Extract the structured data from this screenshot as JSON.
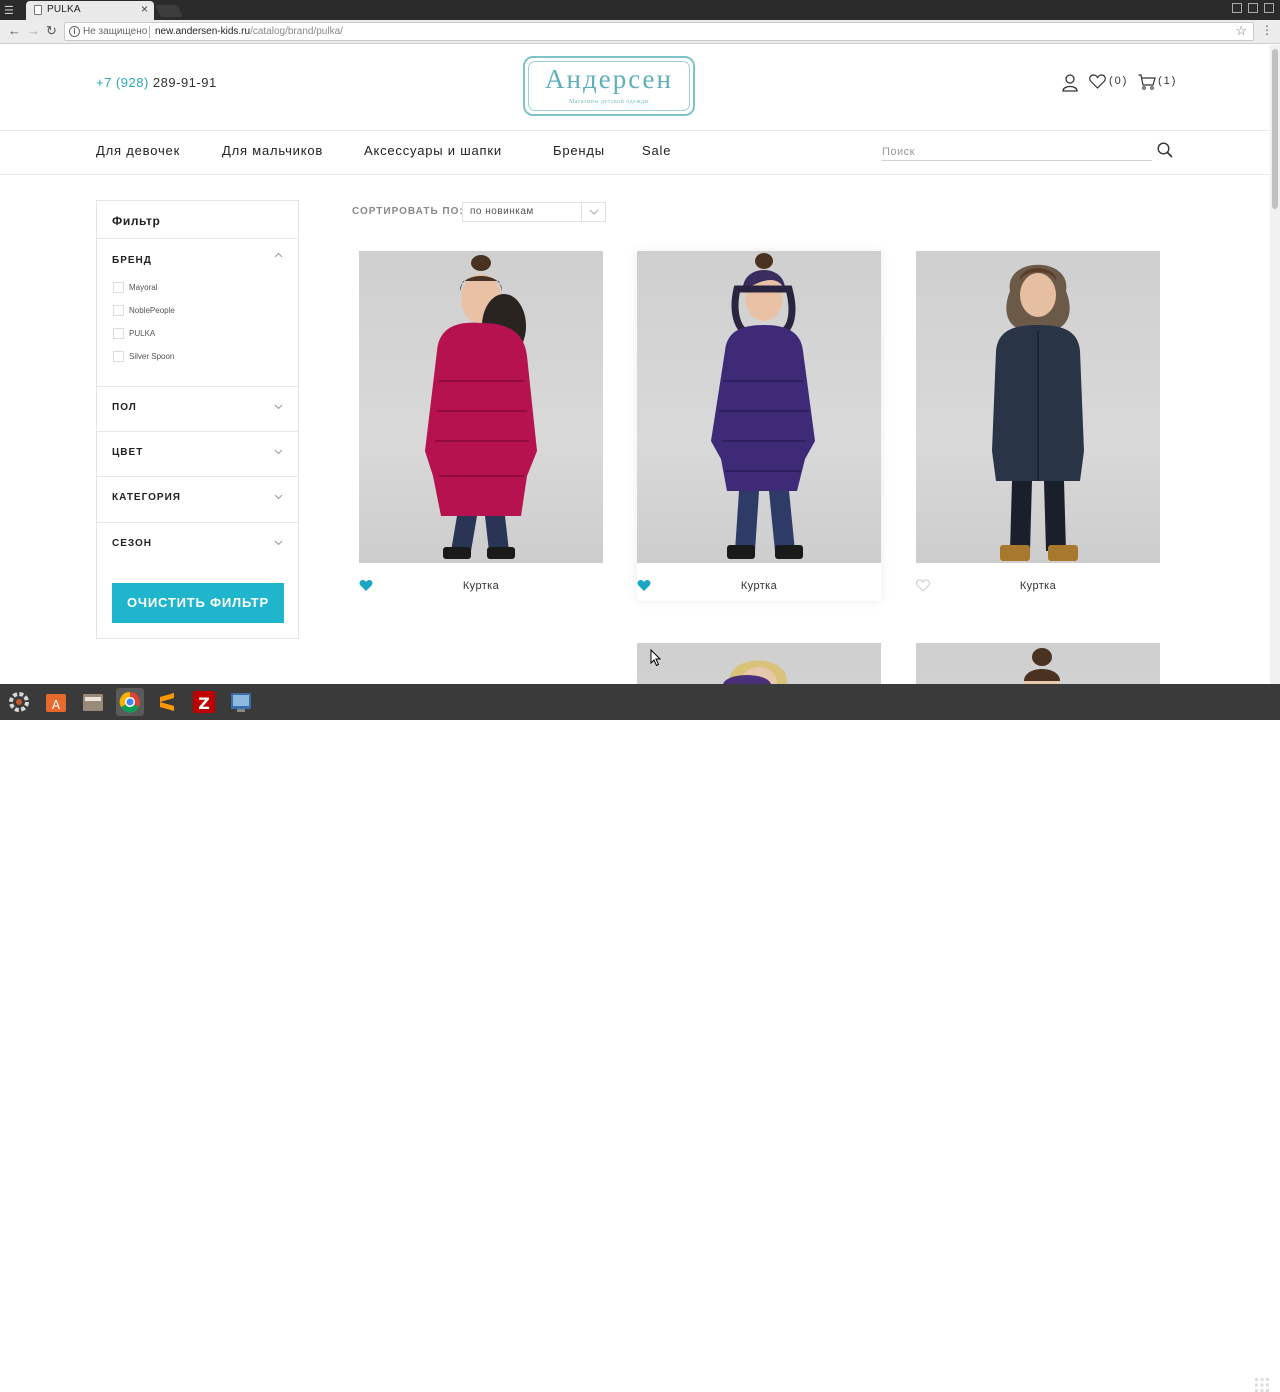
{
  "browser": {
    "tab_title": "PULKA",
    "insecure_label": "Не защищено",
    "url_host": "new.andersen-kids.ru",
    "url_path": "/catalog/brand/pulka/"
  },
  "header": {
    "phone_code": "+7 (928)",
    "phone_number": "289-91-91",
    "logo_name": "Андерсен",
    "logo_sub": "Магазины детской одежды",
    "wishlist_count": "(0)",
    "cart_count": "(1)"
  },
  "nav": {
    "items": [
      "Для девочек",
      "Для мальчиков",
      "Аксессуары и шапки",
      "Бренды",
      "Sale"
    ],
    "search_placeholder": "Поиск"
  },
  "filter": {
    "title": "Фильтр",
    "brand_heading": "БРЕНД",
    "brands": [
      "Mayoral",
      "NoblePeople",
      "PULKA",
      "Silver Spoon"
    ],
    "sections": [
      "ПОЛ",
      "ЦВЕТ",
      "КАТЕГОРИЯ",
      "СЕЗОН"
    ],
    "clear_button": "ОЧИСТИТЬ ФИЛЬТР"
  },
  "sort": {
    "label": "СОРТИРОВАТЬ ПО:",
    "value": "по новинкам"
  },
  "products": [
    {
      "name": "Куртка",
      "favorite": true,
      "jacket_color": "#b5124f"
    },
    {
      "name": "Куртка",
      "favorite": true,
      "jacket_color": "#3f2a78"
    },
    {
      "name": "Куртка",
      "favorite": false,
      "jacket_color": "#2a3447"
    }
  ],
  "colors": {
    "accent": "#1fb5cc",
    "heart_active": "#1aa6c4"
  }
}
